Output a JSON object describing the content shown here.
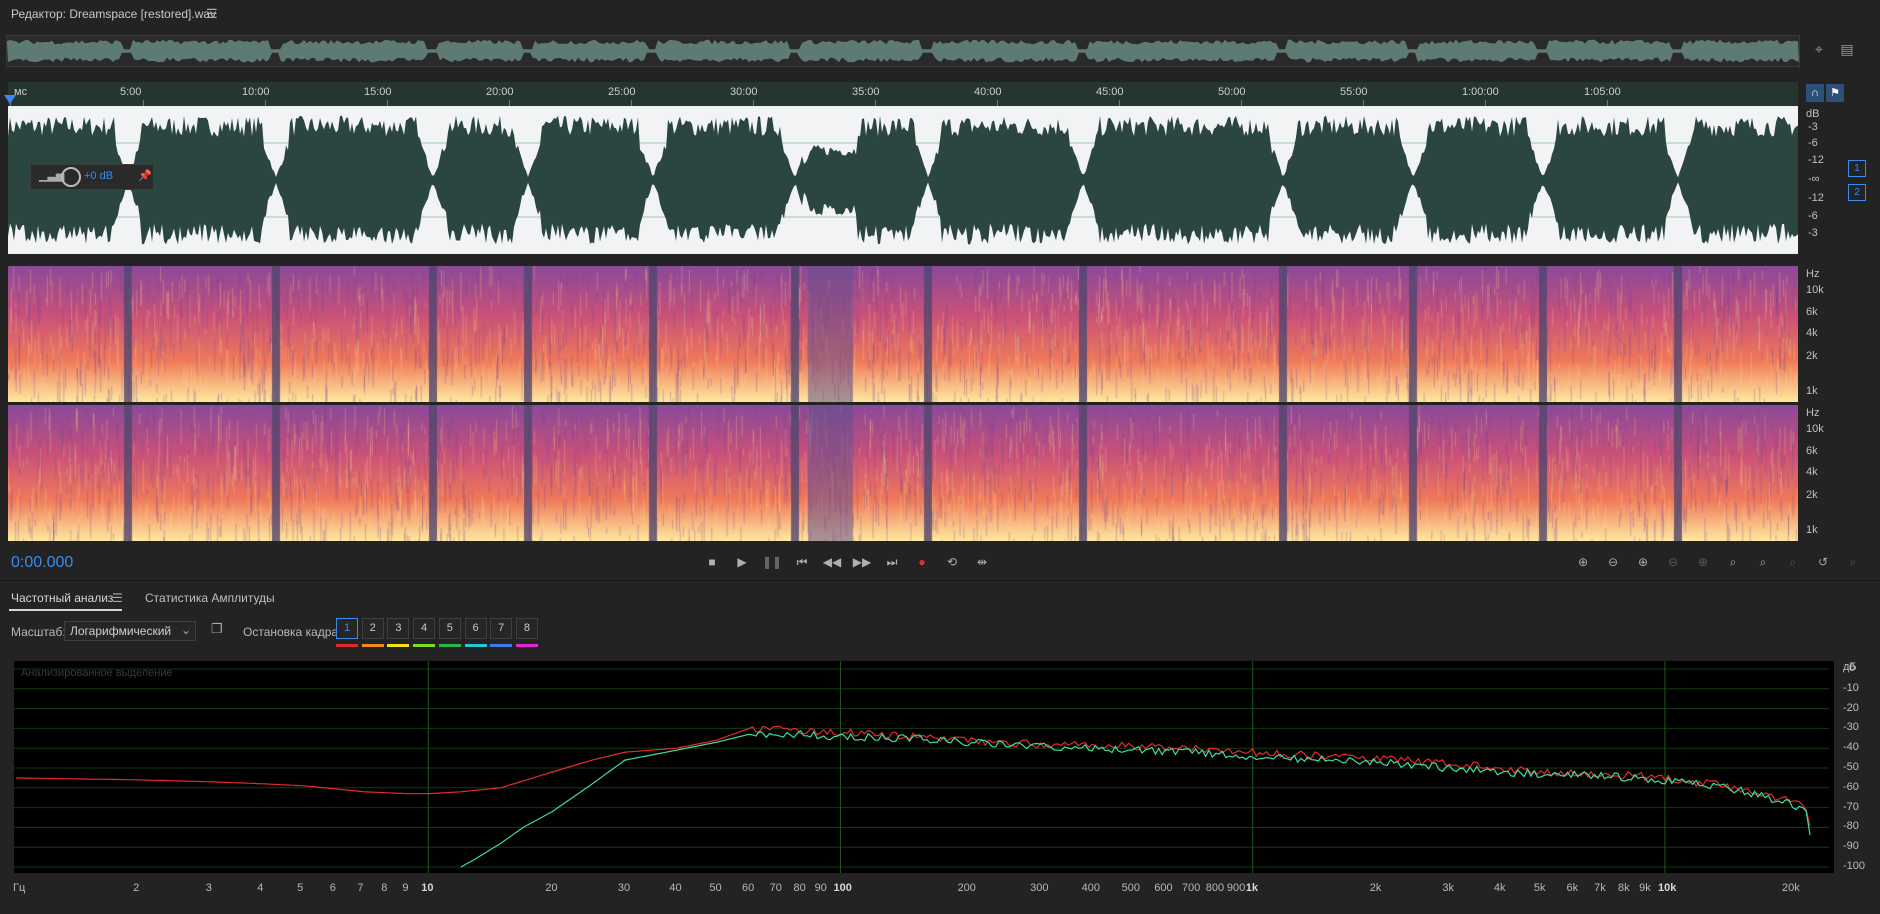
{
  "titlebar": {
    "title": "Редактор: Dreamspace [restored].wav",
    "menu_icon": "hamburger-icon"
  },
  "ruler": {
    "ticks": [
      "мс",
      "5:00",
      "10:00",
      "15:00",
      "20:00",
      "25:00",
      "30:00",
      "35:00",
      "40:00",
      "45:00",
      "50:00",
      "55:00",
      "1:00:00",
      "1:05:00"
    ]
  },
  "wave_scale": {
    "unit": "dB",
    "labels": [
      "-3",
      "-6",
      "-12",
      "-∞",
      "-12",
      "-6",
      "-3"
    ],
    "channels": [
      "1",
      "2"
    ]
  },
  "hud": {
    "gain": "+0 dB"
  },
  "spectral_scale": {
    "unit": "Hz",
    "labels": [
      "10k",
      "6k",
      "4k",
      "2k",
      "1k"
    ]
  },
  "timecode": "0:00.000",
  "transport": {
    "icons": [
      "stop-icon",
      "play-icon",
      "pause-icon",
      "skip-start-icon",
      "rewind-icon",
      "fast-forward-icon",
      "skip-end-icon",
      "record-icon",
      "loop-icon",
      "skip-selection-icon"
    ]
  },
  "zoom": {
    "icons": [
      "zoom-in-amplitude-icon",
      "zoom-out-amplitude-icon",
      "zoom-in-time-icon",
      "zoom-out-time-icon",
      "zoom-in-in-point-icon",
      "zoom-in-out-point-icon",
      "zoom-selection-icon",
      "zoom-out-full-icon",
      "zoom-reset-icon",
      "zoom-fit-icon"
    ]
  },
  "tabs": [
    {
      "label": "Частотный анализ",
      "active": true
    },
    {
      "label": "Статистика Амплитуды",
      "active": false
    }
  ],
  "analysis": {
    "scale_label": "Масштаб:",
    "scale_value": "Логарифмический",
    "freeze_label": "Остановка кадра:",
    "frames": [
      {
        "label": "1",
        "color": "#e02a2a"
      },
      {
        "label": "2",
        "color": "#f08c1e"
      },
      {
        "label": "3",
        "color": "#f2e21a"
      },
      {
        "label": "4",
        "color": "#7ddb24"
      },
      {
        "label": "5",
        "color": "#28b84a"
      },
      {
        "label": "6",
        "color": "#22c8d8"
      },
      {
        "label": "7",
        "color": "#3a7cf0"
      },
      {
        "label": "8",
        "color": "#e02ad0"
      }
    ],
    "plot_caption": "Анализированное выделение"
  },
  "chart_data": {
    "type": "line",
    "title": "",
    "xlabel": "Гц",
    "ylabel": "дБ",
    "x_scale": "log",
    "xlim": [
      1,
      25000
    ],
    "ylim": [
      -100,
      0
    ],
    "xtick_labels": [
      "Гц",
      "2",
      "3",
      "4",
      "5",
      "6",
      "7",
      "8",
      "9",
      "10",
      "20",
      "30",
      "40",
      "50",
      "60",
      "70",
      "80",
      "90",
      "100",
      "200",
      "300",
      "400",
      "500",
      "600",
      "700",
      "800",
      "900",
      "1k",
      "2k",
      "3k",
      "4k",
      "5k",
      "6k",
      "7k",
      "8k",
      "9k",
      "10k",
      "20k"
    ],
    "ytick_labels": [
      "0",
      "-10",
      "-20",
      "-30",
      "-40",
      "-50",
      "-60",
      "-70",
      "-80",
      "-90",
      "-100"
    ],
    "grid": true,
    "series": [
      {
        "color": "#e62a2a",
        "x": [
          1,
          2,
          3,
          4,
          5,
          7,
          9,
          10,
          12,
          15,
          20,
          25,
          30,
          40,
          50,
          60,
          80,
          100,
          150,
          200,
          300,
          400,
          500,
          700,
          1000,
          1500,
          2000,
          3000,
          4000,
          5000,
          7000,
          10000,
          15000,
          20000,
          22000,
          23000
        ],
        "y": [
          -55,
          -56,
          -57,
          -58,
          -59,
          -62,
          -63,
          -63,
          -62,
          -60,
          -52,
          -46,
          -42,
          -40,
          -36,
          -30,
          -31,
          -32,
          -34,
          -36,
          -38,
          -39,
          -39,
          -40,
          -42,
          -44,
          -45,
          -48,
          -50,
          -52,
          -53,
          -55,
          -60,
          -66,
          -70,
          -88
        ]
      },
      {
        "color": "#3adfa0",
        "x": [
          12,
          13,
          15,
          17,
          20,
          25,
          30,
          40,
          50,
          60,
          80,
          100,
          150,
          200,
          300,
          400,
          500,
          700,
          1000,
          1500,
          2000,
          3000,
          4000,
          5000,
          7000,
          10000,
          15000,
          20000,
          22000,
          23000
        ],
        "y": [
          -100,
          -96,
          -88,
          -80,
          -72,
          -58,
          -46,
          -41,
          -37,
          -33,
          -33,
          -34,
          -35,
          -37,
          -39,
          -40,
          -41,
          -42,
          -44,
          -46,
          -47,
          -50,
          -52,
          -53,
          -54,
          -56,
          -61,
          -68,
          -73,
          -92
        ]
      }
    ]
  }
}
